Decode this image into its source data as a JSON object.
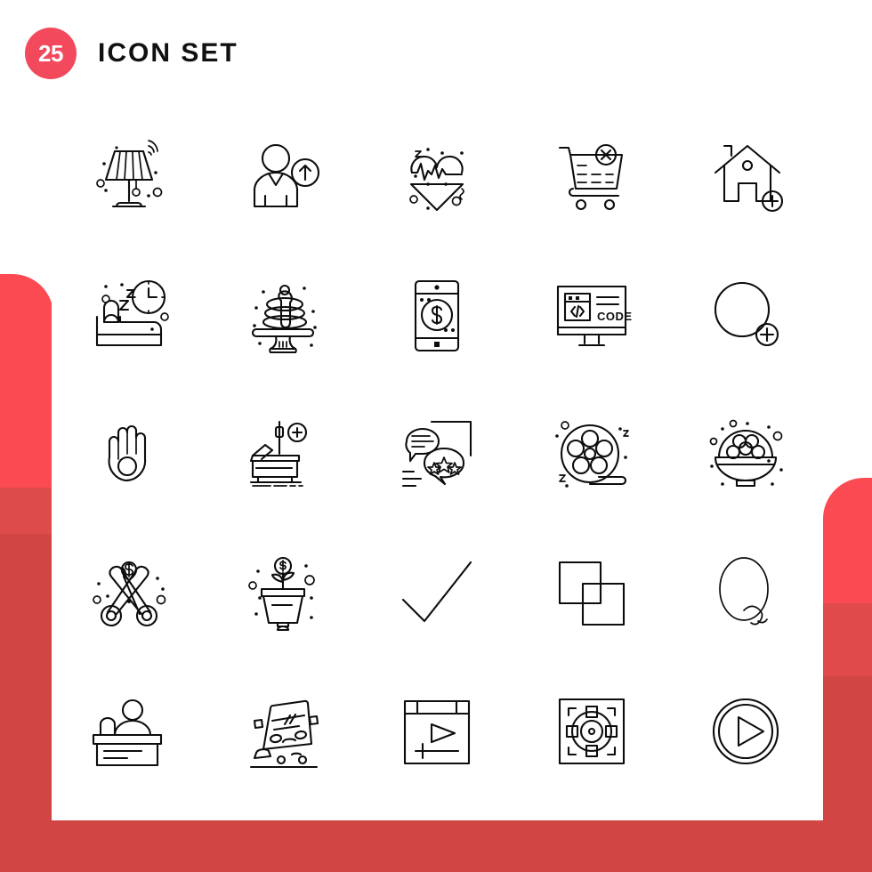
{
  "header": {
    "count": "25",
    "title": "ICON SET",
    "badge_color": "#f2495c",
    "title_color": "#111111"
  },
  "theme": {
    "background": "#ffffff",
    "card_background": "#ffffff",
    "accent_light": "#fb4a52",
    "accent_mid": "#e04a4b",
    "accent_dark": "#d24545",
    "icon_stroke": "#0d0d0d"
  },
  "grid": {
    "columns": 5,
    "rows": 5,
    "total": 25
  },
  "icons": [
    {
      "index": 1,
      "name": "smart-lamp-icon",
      "label": "Smart Lamp"
    },
    {
      "index": 2,
      "name": "user-upload-icon",
      "label": "User Upload"
    },
    {
      "index": 3,
      "name": "heart-rate-down-icon",
      "label": "Heart Rate Down"
    },
    {
      "index": 4,
      "name": "cart-remove-icon",
      "label": "Remove From Cart"
    },
    {
      "index": 5,
      "name": "add-home-icon",
      "label": "Add Home"
    },
    {
      "index": 6,
      "name": "bedtime-clock-icon",
      "label": "Bedtime"
    },
    {
      "index": 7,
      "name": "pancake-stand-icon",
      "label": "Pancakes"
    },
    {
      "index": 8,
      "name": "mobile-payment-icon",
      "label": "Mobile Payment"
    },
    {
      "index": 9,
      "name": "code-monitor-icon",
      "label": "Code",
      "text": "CODE",
      "glyph": "</>"
    },
    {
      "index": 10,
      "name": "add-circle-icon",
      "label": "Add Circle"
    },
    {
      "index": 11,
      "name": "hand-palm-icon",
      "label": "Hand"
    },
    {
      "index": 12,
      "name": "hospital-bed-icon",
      "label": "Hospital Bed"
    },
    {
      "index": 13,
      "name": "chat-review-icon",
      "label": "Chat Review"
    },
    {
      "index": 14,
      "name": "film-reel-icon",
      "label": "Film Reel"
    },
    {
      "index": 15,
      "name": "sweets-bowl-icon",
      "label": "Bowl Of Sweets"
    },
    {
      "index": 16,
      "name": "cost-cutting-icon",
      "label": "Cost Cutting"
    },
    {
      "index": 17,
      "name": "money-plant-icon",
      "label": "Money Plant"
    },
    {
      "index": 18,
      "name": "check-mark-icon",
      "label": "Check Mark"
    },
    {
      "index": 19,
      "name": "copy-squares-icon",
      "label": "Copy"
    },
    {
      "index": 20,
      "name": "letter-q-icon",
      "label": "Letter Q"
    },
    {
      "index": 21,
      "name": "reception-desk-icon",
      "label": "Reception Desk"
    },
    {
      "index": 22,
      "name": "car-crash-icon",
      "label": "Car Crash"
    },
    {
      "index": 23,
      "name": "video-window-icon",
      "label": "Video Window"
    },
    {
      "index": 24,
      "name": "focus-target-icon",
      "label": "Focus Target"
    },
    {
      "index": 25,
      "name": "play-button-icon",
      "label": "Play"
    }
  ]
}
